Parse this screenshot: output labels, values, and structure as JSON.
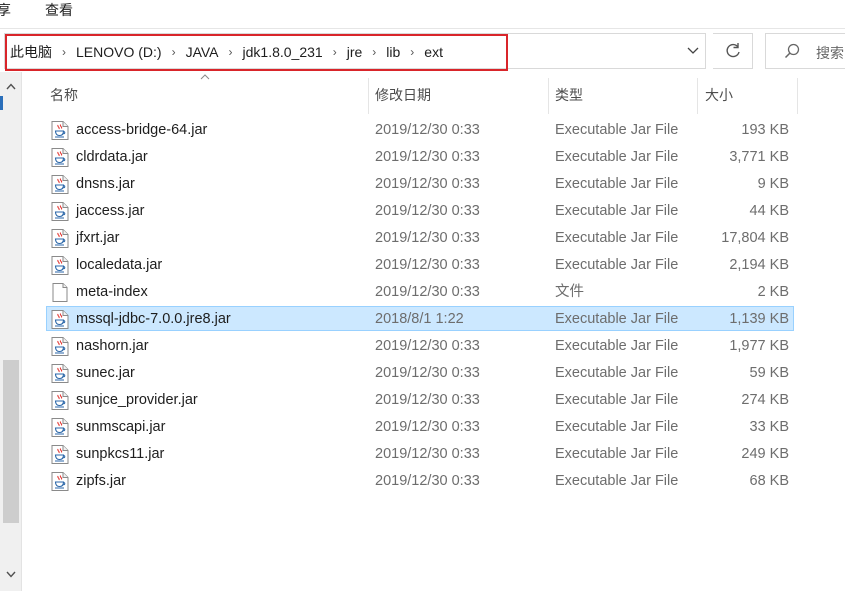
{
  "ribbon": {
    "tabs": [
      "享",
      "查看"
    ]
  },
  "address": {
    "breadcrumbs": [
      "此电脑",
      "LENOVO (D:)",
      "JAVA",
      "jdk1.8.0_231",
      "jre",
      "lib",
      "ext"
    ],
    "search_placeholder": "搜索"
  },
  "columns": {
    "name": "名称",
    "date": "修改日期",
    "type": "类型",
    "size": "大小"
  },
  "files": [
    {
      "name": "access-bridge-64.jar",
      "date": "2019/12/30 0:33",
      "type": "Executable Jar File",
      "size": "193 KB",
      "icon": "jar-icon"
    },
    {
      "name": "cldrdata.jar",
      "date": "2019/12/30 0:33",
      "type": "Executable Jar File",
      "size": "3,771 KB",
      "icon": "jar-icon"
    },
    {
      "name": "dnsns.jar",
      "date": "2019/12/30 0:33",
      "type": "Executable Jar File",
      "size": "9 KB",
      "icon": "jar-icon"
    },
    {
      "name": "jaccess.jar",
      "date": "2019/12/30 0:33",
      "type": "Executable Jar File",
      "size": "44 KB",
      "icon": "jar-icon"
    },
    {
      "name": "jfxrt.jar",
      "date": "2019/12/30 0:33",
      "type": "Executable Jar File",
      "size": "17,804 KB",
      "icon": "jar-icon"
    },
    {
      "name": "localedata.jar",
      "date": "2019/12/30 0:33",
      "type": "Executable Jar File",
      "size": "2,194 KB",
      "icon": "jar-icon"
    },
    {
      "name": "meta-index",
      "date": "2019/12/30 0:33",
      "type": "文件",
      "size": "2 KB",
      "icon": "file-icon"
    },
    {
      "name": "mssql-jdbc-7.0.0.jre8.jar",
      "date": "2018/8/1 1:22",
      "type": "Executable Jar File",
      "size": "1,139 KB",
      "icon": "jar-icon",
      "selected": true
    },
    {
      "name": "nashorn.jar",
      "date": "2019/12/30 0:33",
      "type": "Executable Jar File",
      "size": "1,977 KB",
      "icon": "jar-icon"
    },
    {
      "name": "sunec.jar",
      "date": "2019/12/30 0:33",
      "type": "Executable Jar File",
      "size": "59 KB",
      "icon": "jar-icon"
    },
    {
      "name": "sunjce_provider.jar",
      "date": "2019/12/30 0:33",
      "type": "Executable Jar File",
      "size": "274 KB",
      "icon": "jar-icon"
    },
    {
      "name": "sunmscapi.jar",
      "date": "2019/12/30 0:33",
      "type": "Executable Jar File",
      "size": "33 KB",
      "icon": "jar-icon"
    },
    {
      "name": "sunpkcs11.jar",
      "date": "2019/12/30 0:33",
      "type": "Executable Jar File",
      "size": "249 KB",
      "icon": "jar-icon"
    },
    {
      "name": "zipfs.jar",
      "date": "2019/12/30 0:33",
      "type": "Executable Jar File",
      "size": "68 KB",
      "icon": "jar-icon"
    }
  ],
  "colors": {
    "highlight_border": "#d9252a",
    "selected_bg": "#cce8ff",
    "selected_border": "#99d1ff",
    "java_cup_red": "#e2312d",
    "java_cup_blue": "#2a66a8"
  }
}
